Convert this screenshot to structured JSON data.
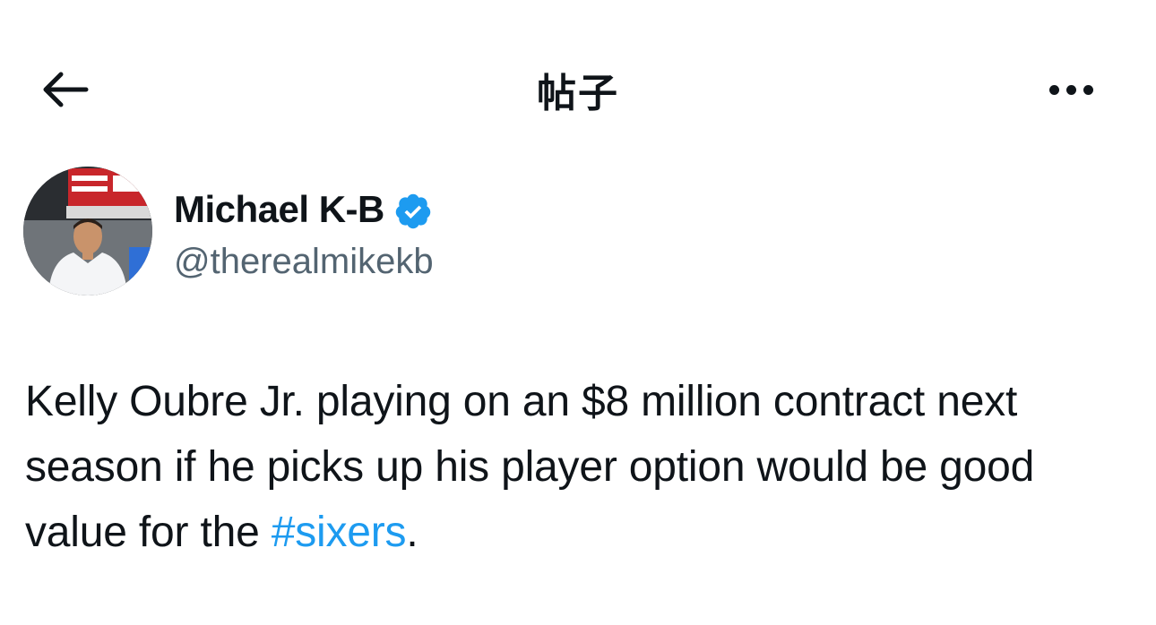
{
  "header": {
    "title": "帖子",
    "back_icon": "arrow-left-icon",
    "more_icon": "more-horizontal-icon"
  },
  "author": {
    "display_name": "Michael K-B",
    "handle": "@therealmikekb",
    "verified": true,
    "verified_color": "#1d9bf0"
  },
  "tweet": {
    "text_before": "Kelly Oubre Jr. playing on an $8 million contract next season if he picks up his player option would be good value for the ",
    "hashtag": "#sixers",
    "text_after": "."
  },
  "colors": {
    "text": "#0f1419",
    "secondary": "#536471",
    "link": "#1d9bf0"
  }
}
